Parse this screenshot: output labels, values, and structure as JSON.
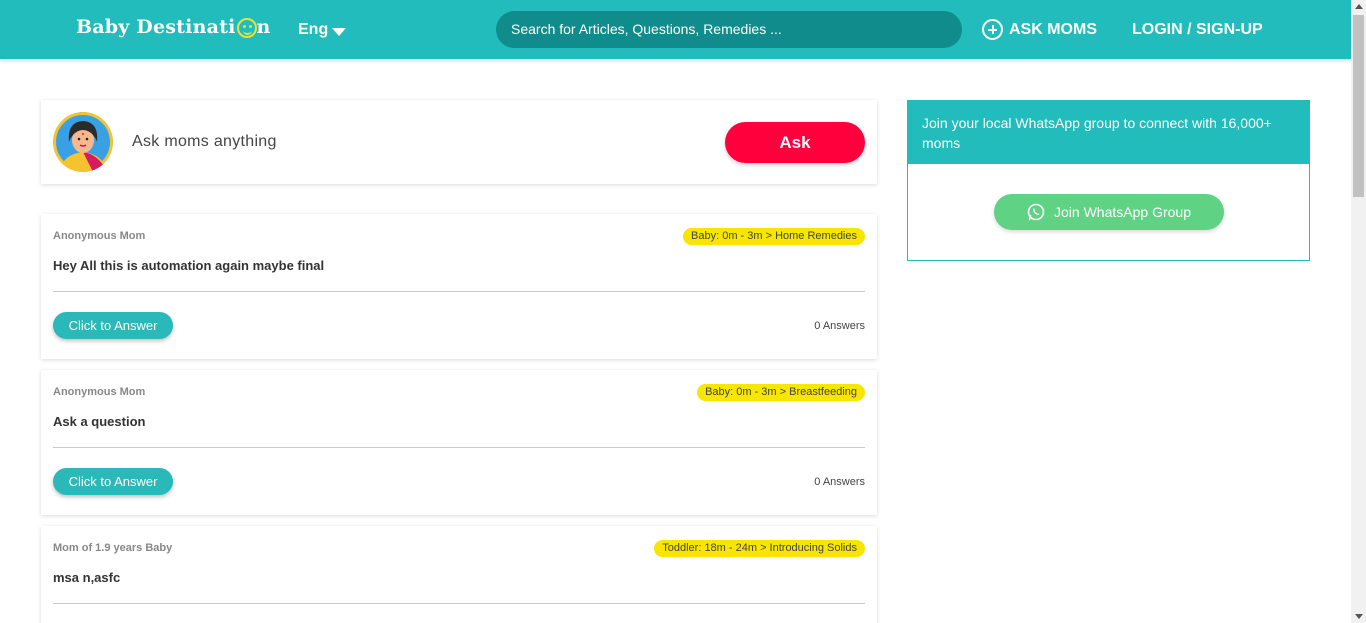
{
  "header": {
    "logo_text_1": "Baby Destinati",
    "logo_text_2": "n",
    "language": "Eng",
    "search_placeholder": "Search for Articles, Questions, Remedies ...",
    "ask_moms": "ASK MOMS",
    "login": "LOGIN / SIGN-UP"
  },
  "ask": {
    "placeholder": "Ask moms anything",
    "button": "Ask"
  },
  "questions": [
    {
      "author": "Anonymous Mom",
      "tag": "Baby: 0m - 3m > Home Remedies",
      "title": "Hey All this is automation again maybe final",
      "answer_button": "Click to Answer",
      "answers": "0 Answers"
    },
    {
      "author": "Anonymous Mom",
      "tag": "Baby: 0m - 3m > Breastfeeding",
      "title": "Ask a question",
      "answer_button": "Click to Answer",
      "answers": "0 Answers"
    },
    {
      "author": "Mom of 1.9 years Baby",
      "tag": "Toddler: 18m - 24m > Introducing Solids",
      "title": "msa n,asfc",
      "answer_button": "Click to Answer",
      "answers": ""
    }
  ],
  "whatsapp": {
    "heading": "Join your local WhatsApp group to connect with 16,000+ moms",
    "button": "Join WhatsApp Group"
  },
  "colors": {
    "brand": "#22bcbc",
    "ask_button": "#ff003c",
    "tag": "#f7e600",
    "whatsapp": "#5fd283"
  }
}
